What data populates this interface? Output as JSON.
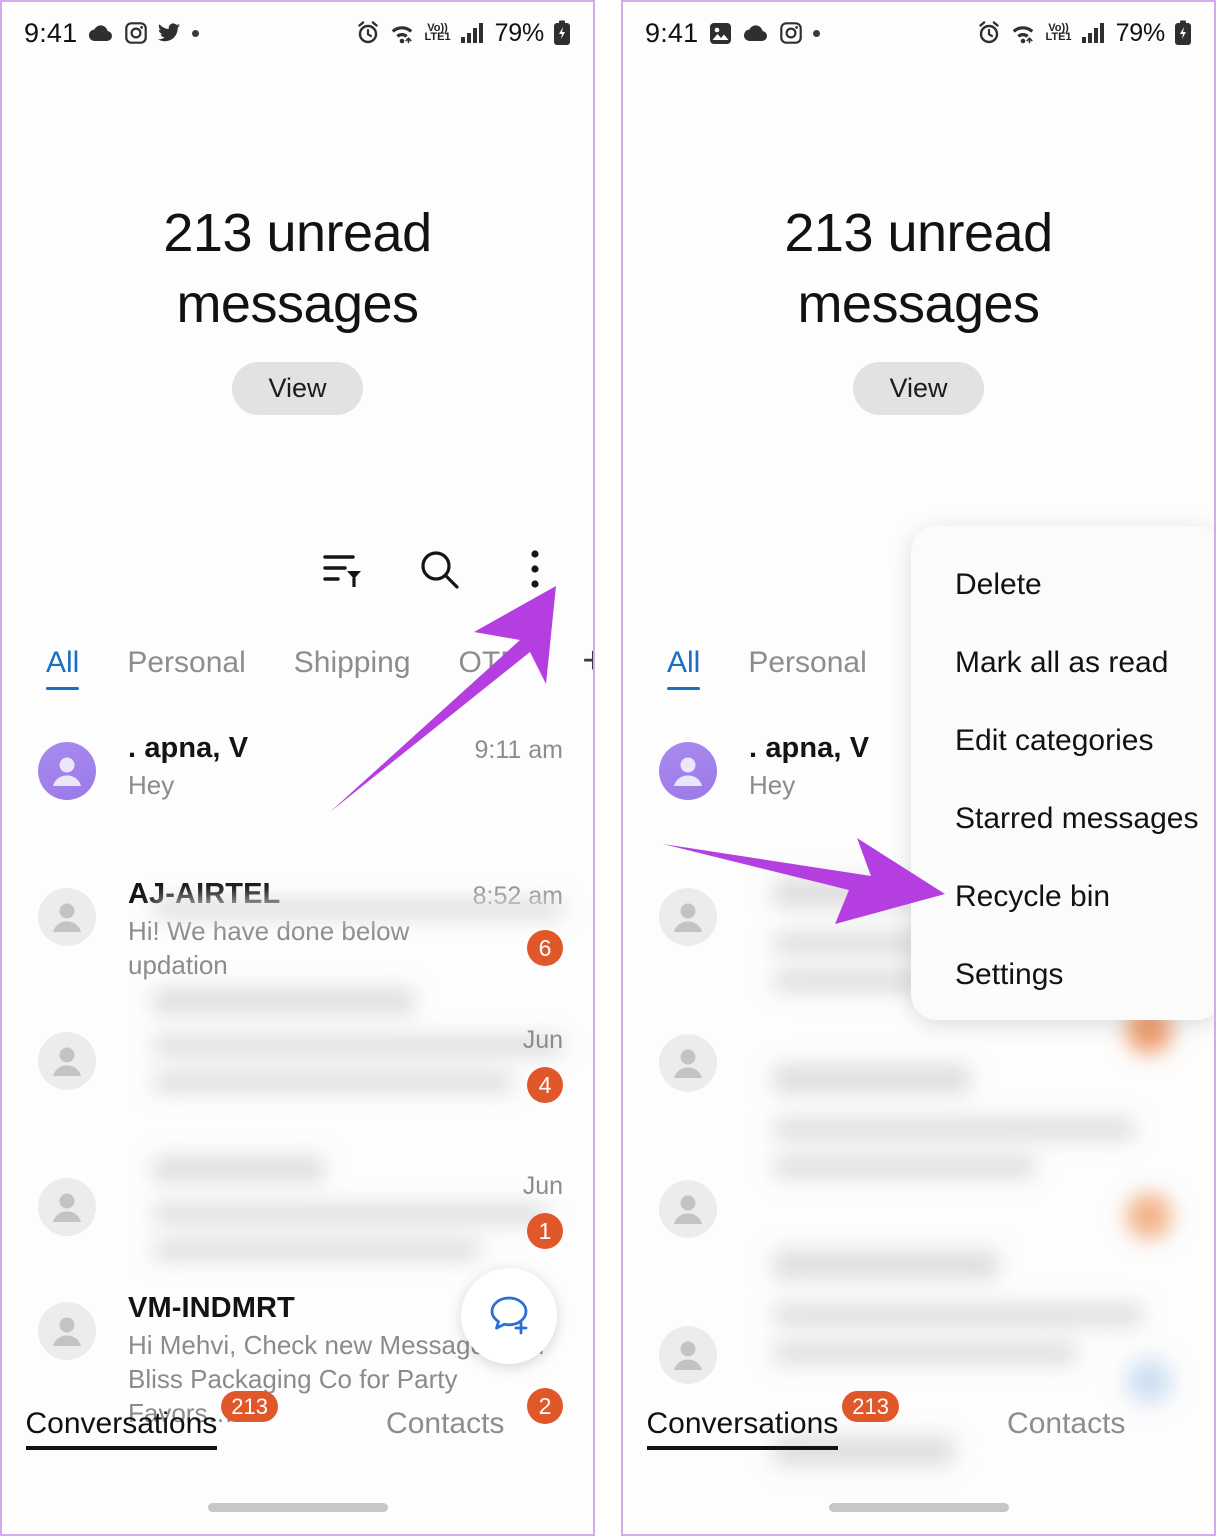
{
  "accent": {
    "arrow_purple": "#b43ee0",
    "badge_orange": "#e0582a",
    "tab_blue": "#1b6ec2",
    "frame_border": "#d9a8ea"
  },
  "left_panel": {
    "status_bar": {
      "time": "9:41",
      "left_icons": [
        "cloud-icon",
        "instagram-icon",
        "twitter-icon",
        "dot-icon"
      ],
      "right_icons": [
        "alarm-icon",
        "wifi-icon",
        "volte-icon",
        "signal-icon"
      ],
      "network_label": "Vo))",
      "network_sub": "LTE1",
      "battery_percent": "79%"
    },
    "header": {
      "title": "213 unread messages",
      "view_label": "View"
    },
    "toolbar": {
      "sort_icon": "sort-filter-icon",
      "search_icon": "search-icon",
      "more_icon": "more-vertical-icon"
    },
    "tabs": [
      {
        "label": "All",
        "active": true
      },
      {
        "label": "Personal",
        "active": false
      },
      {
        "label": "Shipping",
        "active": false
      },
      {
        "label": "OTP",
        "active": false
      }
    ],
    "tab_add_label": "+",
    "conversations": [
      {
        "name": ". apna, V",
        "snippet": "Hey",
        "time": "9:11 am",
        "badge": "",
        "avatar": "purple",
        "blurred": false
      },
      {
        "name": "AJ-AIRTEL",
        "snippet": "Hi! We have done below updation",
        "time": "8:52 am",
        "badge": "6",
        "avatar": "grey",
        "blurred": false
      },
      {
        "name": "",
        "snippet": "",
        "time": "Jun",
        "badge": "4",
        "avatar": "grey",
        "blurred": true
      },
      {
        "name": "",
        "snippet": "",
        "time": "Jun",
        "badge": "1",
        "avatar": "grey",
        "blurred": true
      },
      {
        "name": "VM-INDMRT",
        "snippet": "Hi Mehvi, Check new Message from Bliss Packaging Co for Party Favors…",
        "time": "",
        "badge": "2",
        "avatar": "grey",
        "blurred": false
      }
    ],
    "fab_icon": "new-message-icon",
    "bottom_nav": [
      {
        "label": "Conversations",
        "badge": "213",
        "active": true
      },
      {
        "label": "Contacts",
        "badge": "",
        "active": false
      }
    ],
    "annotation": {
      "arrow": "arrow-pointing-to-more-menu"
    }
  },
  "right_panel": {
    "status_bar": {
      "time": "9:41",
      "left_icons": [
        "image-icon",
        "cloud-icon",
        "instagram-icon",
        "dot-icon"
      ],
      "right_icons": [
        "alarm-icon",
        "wifi-icon",
        "volte-icon",
        "signal-icon"
      ],
      "network_label": "Vo))",
      "network_sub": "LTE1",
      "battery_percent": "79%"
    },
    "header": {
      "title": "213 unread messages",
      "view_label": "View"
    },
    "tabs": [
      {
        "label": "All",
        "active": true
      },
      {
        "label": "Personal",
        "active": false
      }
    ],
    "conversations": [
      {
        "name": ". apna, V",
        "snippet": "Hey",
        "time": "",
        "badge": "",
        "avatar": "purple",
        "blurred": false
      },
      {
        "name": "",
        "snippet": "",
        "time": "",
        "badge": "",
        "avatar": "grey",
        "blurred": true
      },
      {
        "name": "",
        "snippet": "",
        "time": "",
        "badge": "",
        "avatar": "grey",
        "blurred": true
      },
      {
        "name": "",
        "snippet": "",
        "time": "",
        "badge": "",
        "avatar": "grey",
        "blurred": true
      },
      {
        "name": "",
        "snippet": "",
        "time": "",
        "badge": "",
        "avatar": "grey",
        "blurred": true
      }
    ],
    "menu": {
      "items": [
        "Delete",
        "Mark all as read",
        "Edit categories",
        "Starred messages",
        "Recycle bin",
        "Settings"
      ],
      "highlighted": "Recycle bin"
    },
    "bottom_nav": [
      {
        "label": "Conversations",
        "badge": "213",
        "active": true
      },
      {
        "label": "Contacts",
        "badge": "",
        "active": false
      }
    ],
    "annotation": {
      "arrow": "arrow-pointing-to-recycle-bin"
    }
  }
}
